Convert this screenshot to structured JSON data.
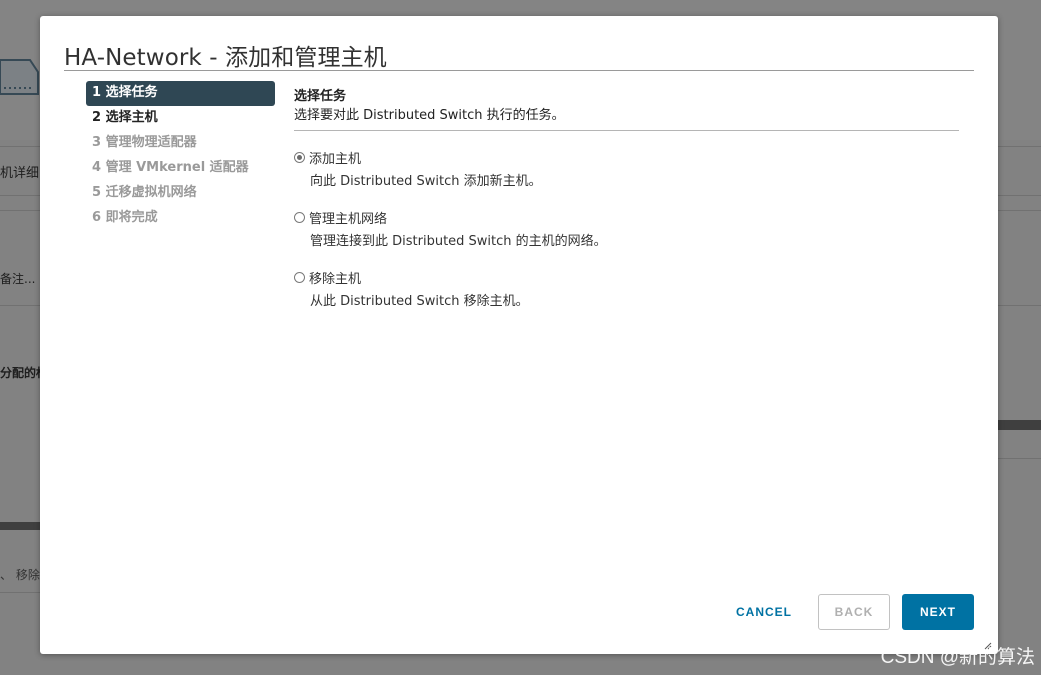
{
  "background": {
    "frag_details": "机详细",
    "frag_notes": "备注...",
    "frag_assigned": "分配的标",
    "frag_remove": "、 移除"
  },
  "dialog": {
    "title": "HA-Network - 添加和管理主机"
  },
  "steps": [
    {
      "label": "1 选择任务",
      "state": "current"
    },
    {
      "label": "2 选择主机",
      "state": "enabled"
    },
    {
      "label": "3 管理物理适配器",
      "state": "disabled"
    },
    {
      "label": "4 管理 VMkernel 适配器",
      "state": "disabled"
    },
    {
      "label": "5 迁移虚拟机网络",
      "state": "disabled"
    },
    {
      "label": "6 即将完成",
      "state": "disabled"
    }
  ],
  "content": {
    "title": "选择任务",
    "description": "选择要对此 Distributed Switch 执行的任务。",
    "options": [
      {
        "label": "添加主机",
        "description": "向此 Distributed Switch 添加新主机。",
        "selected": true
      },
      {
        "label": "管理主机网络",
        "description": "管理连接到此 Distributed Switch 的主机的网络。",
        "selected": false
      },
      {
        "label": "移除主机",
        "description": "从此 Distributed Switch 移除主机。",
        "selected": false
      }
    ]
  },
  "buttons": {
    "cancel": "CANCEL",
    "back": "BACK",
    "next": "NEXT"
  },
  "colors": {
    "primary": "#0072a3",
    "current_step_bg": "#2f4754"
  },
  "watermark": "CSDN @新的算法"
}
